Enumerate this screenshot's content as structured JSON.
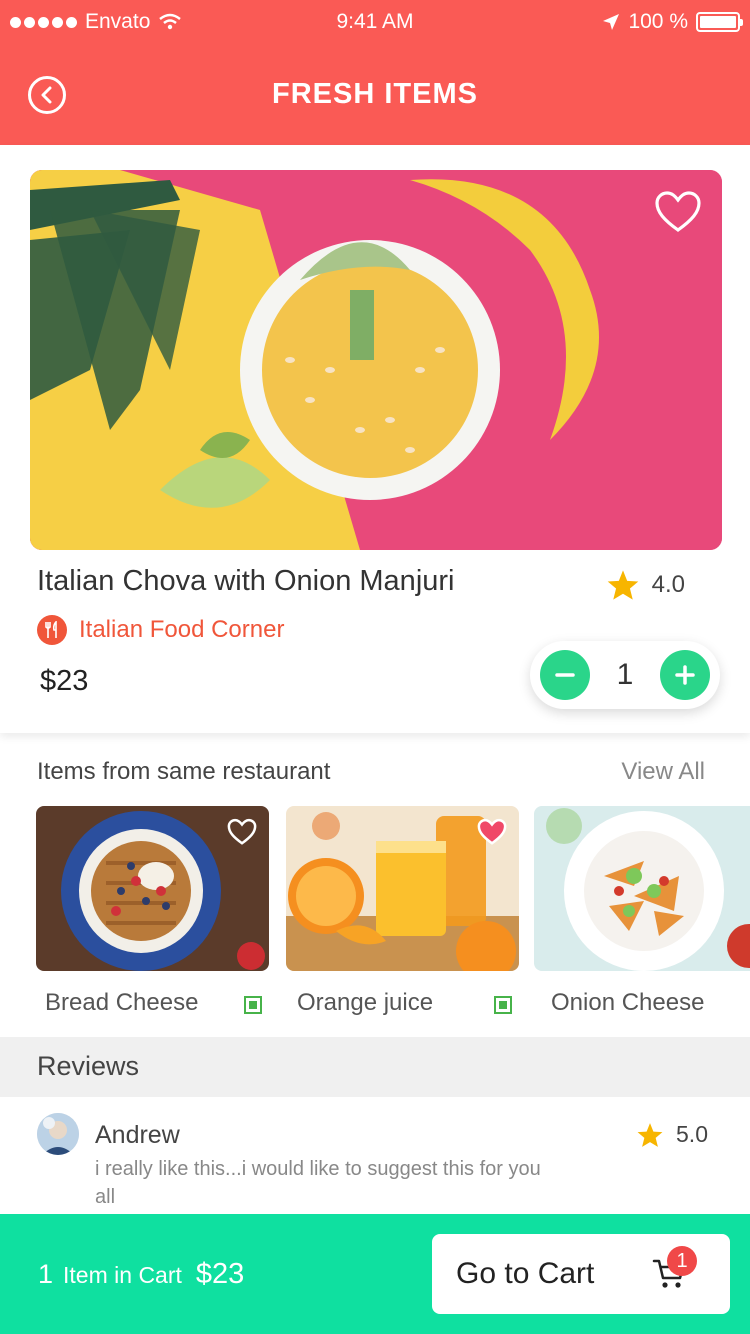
{
  "status_bar": {
    "carrier": "Envato",
    "time": "9:41 AM",
    "battery": "100 %"
  },
  "header": {
    "title": "FRESH ITEMS"
  },
  "product": {
    "name": "Italian Chova with Onion Manjuri",
    "rating": "4.0",
    "restaurant": "Italian Food Corner",
    "price": "$23",
    "quantity": "1",
    "favorited": false
  },
  "same_restaurant": {
    "title": "Items from same restaurant",
    "view_all": "View All",
    "items": [
      {
        "label": "Bread Cheese",
        "favorited": false,
        "veg": true
      },
      {
        "label": "Orange juice",
        "favorited": true,
        "veg": true
      },
      {
        "label": "Onion Cheese",
        "favorited": false,
        "veg": false
      }
    ]
  },
  "reviews": {
    "title": "Reviews",
    "items": [
      {
        "name": "Andrew",
        "rating": "5.0",
        "text": "i really like this...i would like to suggest this for you all"
      }
    ]
  },
  "cart": {
    "count": "1",
    "label": "Item in Cart",
    "total": "$23",
    "button_label": "Go to Cart",
    "badge": "1"
  },
  "colors": {
    "header": "#fa5a55",
    "accent_green": "#2ad58a",
    "cart_bar": "#0fe0a0",
    "restaurant": "#f0563a",
    "star": "#f7b500",
    "favorite": "#f04868"
  }
}
